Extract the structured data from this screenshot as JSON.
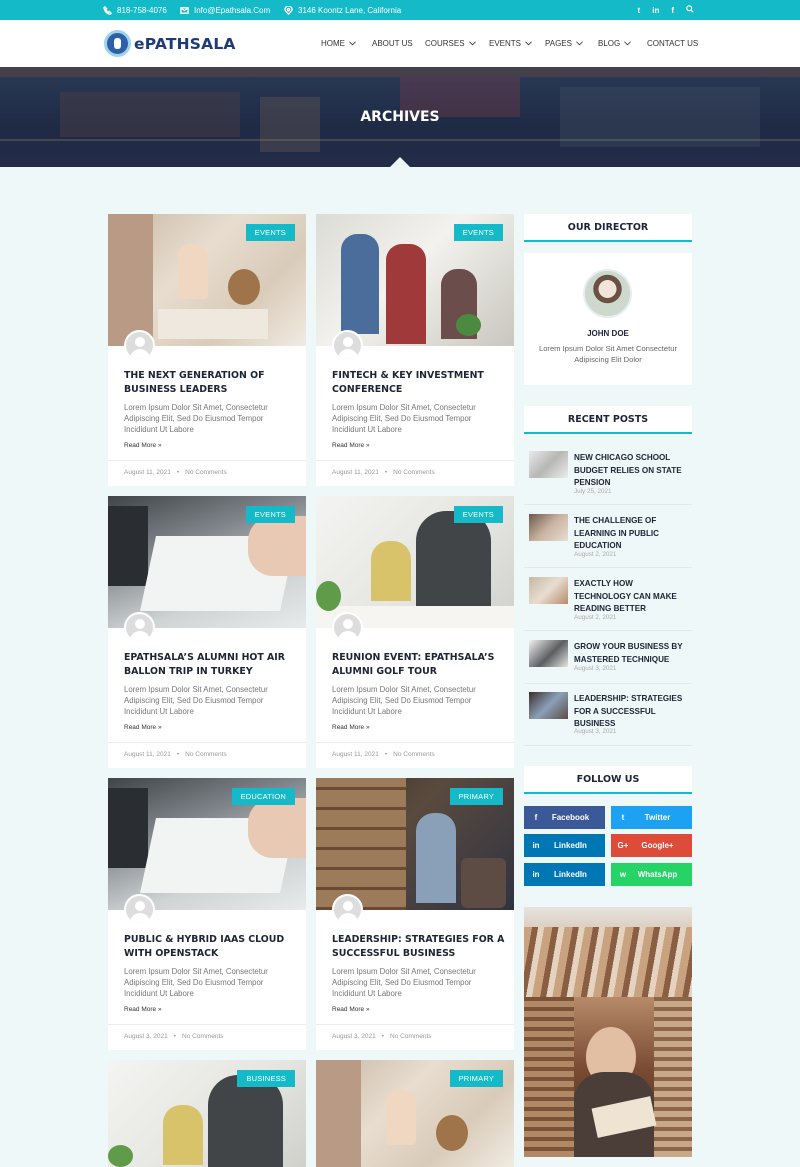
{
  "topbar": {
    "phone": "818-758-4076",
    "email": "Info@Epathsala.Com",
    "address": "3146 Koontz Lane, California",
    "social": [
      "twitter-icon",
      "linkedin-icon",
      "facebook-icon",
      "search-icon"
    ]
  },
  "header": {
    "logo_text": "ePATHSALA",
    "nav": [
      {
        "label": "HOME",
        "dropdown": true
      },
      {
        "label": "ABOUT US",
        "dropdown": false
      },
      {
        "label": "COURSES",
        "dropdown": true
      },
      {
        "label": "EVENTS",
        "dropdown": true
      },
      {
        "label": "PAGES",
        "dropdown": true
      },
      {
        "label": "BLOG",
        "dropdown": true
      },
      {
        "label": "CONTACT US",
        "dropdown": false
      }
    ]
  },
  "hero": {
    "title": "ARCHIVES"
  },
  "posts": [
    {
      "tag": "EVENTS",
      "title": "THE NEXT GENERATION OF BUSINESS LEADERS",
      "excerpt": "Lorem Ipsum Dolor Sit Amet, Consectetur Adipiscing Elit, Sed Do Eiusmod Tempor Incididunt Ut Labore",
      "more": "Read More »",
      "date": "August 11, 2021",
      "comments": "No Comments"
    },
    {
      "tag": "EVENTS",
      "title": "FINTECH & KEY INVESTMENT CONFERENCE",
      "excerpt": "Lorem Ipsum Dolor Sit Amet, Consectetur Adipiscing Elit, Sed Do Eiusmod Tempor Incididunt Ut Labore",
      "more": "Read More »",
      "date": "August 11, 2021",
      "comments": "No Comments"
    },
    {
      "tag": "EVENTS",
      "title": "EPATHSALA’S ALUMNI HOT AIR BALLON TRIP IN TURKEY",
      "excerpt": "Lorem Ipsum Dolor Sit Amet, Consectetur Adipiscing Elit, Sed Do Eiusmod Tempor Incididunt Ut Labore",
      "more": "Read More »",
      "date": "August 11, 2021",
      "comments": "No Comments"
    },
    {
      "tag": "EVENTS",
      "title": "REUNION EVENT: EPATHSALA’S ALUMNI GOLF TOUR",
      "excerpt": "Lorem Ipsum Dolor Sit Amet, Consectetur Adipiscing Elit, Sed Do Eiusmod Tempor Incididunt Ut Labore",
      "more": "Read More »",
      "date": "August 11, 2021",
      "comments": "No Comments"
    },
    {
      "tag": "EDUCATION",
      "title": "PUBLIC & HYBRID IAAS CLOUD WITH OPENSTACK",
      "excerpt": "Lorem Ipsum Dolor Sit Amet, Consectetur Adipiscing Elit, Sed Do Eiusmod Tempor Incididunt Ut Labore",
      "more": "Read More »",
      "date": "August 3, 2021",
      "comments": "No Comments"
    },
    {
      "tag": "PRIMARY",
      "title": "LEADERSHIP: STRATEGIES FOR A SUCCESSFUL BUSINESS",
      "excerpt": "Lorem Ipsum Dolor Sit Amet, Consectetur Adipiscing Elit, Sed Do Eiusmod Tempor Incididunt Ut Labore",
      "more": "Read More »",
      "date": "August 3, 2021",
      "comments": "No Comments"
    },
    {
      "tag": "BUSINESS"
    },
    {
      "tag": "PRIMARY"
    }
  ],
  "sidebar": {
    "director_title": "OUR DIRECTOR",
    "director_name": "JOHN DOE",
    "director_desc": "Lorem Ipsum Dolor Sit Amet Consectetur Adipiscing Elit Dolor",
    "recent_title": "RECENT POSTS",
    "recent": [
      {
        "title": "NEW CHICAGO SCHOOL BUDGET RELIES ON STATE PENSION",
        "date": "July 25, 2021"
      },
      {
        "title": "THE CHALLENGE OF LEARNING IN PUBLIC EDUCATION",
        "date": "August 2, 2021"
      },
      {
        "title": "EXACTLY HOW TECHNOLOGY CAN MAKE READING BETTER",
        "date": "August 2, 2021"
      },
      {
        "title": "GROW YOUR BUSINESS BY MASTERED TECHNIQUE",
        "date": "August 3, 2021"
      },
      {
        "title": "LEADERSHIP: STRATEGIES FOR A SUCCESSFUL BUSINESS",
        "date": "August 3, 2021"
      }
    ],
    "follow_title": "FOLLOW US",
    "social": [
      {
        "label": "Facebook",
        "icon": "facebook-icon",
        "glyph": "f",
        "color": "#3b5998"
      },
      {
        "label": "Twitter",
        "icon": "twitter-icon",
        "glyph": "t",
        "color": "#1da1f2"
      },
      {
        "label": "LinkedIn",
        "icon": "linkedin-icon",
        "glyph": "in",
        "color": "#0077b5"
      },
      {
        "label": "Google+",
        "icon": "google-plus-icon",
        "glyph": "G+",
        "color": "#dd4b39"
      },
      {
        "label": "LinkedIn",
        "icon": "linkedin-icon",
        "glyph": "in",
        "color": "#0077b5"
      },
      {
        "label": "WhatsApp",
        "icon": "whatsapp-icon",
        "glyph": "w",
        "color": "#25d366"
      }
    ]
  },
  "colors": {
    "accent": "#14bac8",
    "heading": "#1d2435",
    "logo": "#1f3a78"
  }
}
